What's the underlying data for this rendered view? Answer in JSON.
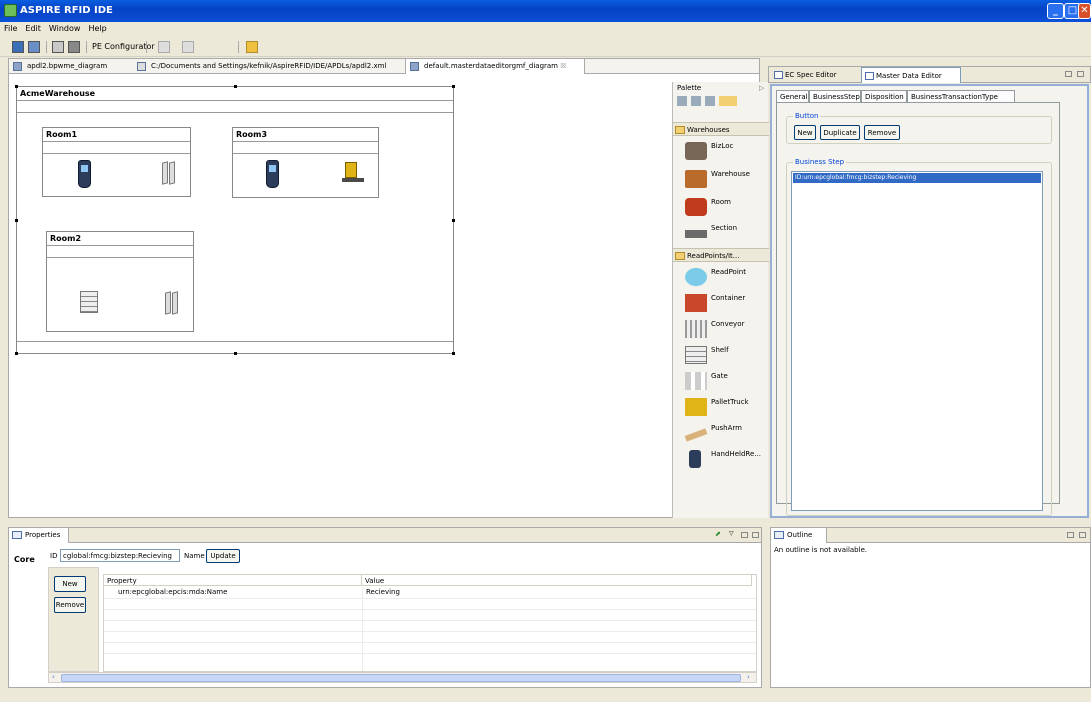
{
  "window": {
    "title": "ASPIRE RFID IDE"
  },
  "menu": [
    "File",
    "Edit",
    "Window",
    "Help"
  ],
  "toolbar": {
    "pe_configurator": "PE Configurator"
  },
  "editor_tabs": [
    {
      "label": "apdl2.bpwme_diagram"
    },
    {
      "label": "C:/Documents and Settings/kefnik/AspireRFID/IDE/APDLs/apdl2.xml"
    },
    {
      "label": "default.masterdataeditorgmf_diagram",
      "close": "☒"
    }
  ],
  "diagram": {
    "warehouse": "AcmeWarehouse",
    "rooms": [
      "Room1",
      "Room3",
      "Room2"
    ]
  },
  "palette": {
    "title": "Palette",
    "group1": "Warehouses",
    "group1_items": [
      "BizLoc",
      "Warehouse",
      "Room",
      "Section"
    ],
    "group2": "ReadPoints/It...",
    "group2_items": [
      "ReadPoint",
      "Container",
      "Conveyor",
      "Shelf",
      "Gate",
      "PalletTruck",
      "PushArm",
      "HandHeldRe..."
    ]
  },
  "right_tabs": [
    "EC Spec Editor",
    "Master Data Editor"
  ],
  "master_data": {
    "tabs": [
      "General",
      "BusinessStep",
      "Disposition",
      "BusinessTransactionType"
    ],
    "button_group": "Button",
    "buttons": [
      "New",
      "Duplicate",
      "Remove"
    ],
    "business_step_group": "Business Step",
    "selected_item": "ID:urn:epcglobal:fmcg:bizstep:Recieving"
  },
  "properties": {
    "tab": "Properties",
    "core_label": "Core",
    "id_label": "ID",
    "id_value": "cglobal:fmcg:bizstep:Recieving",
    "name_label": "Name",
    "update": "Update",
    "new": "New",
    "remove": "Remove",
    "col_property": "Property",
    "col_value": "Value",
    "row_property": "urn:epcglobal:epcis:mda:Name",
    "row_value": "Recieving"
  },
  "outline": {
    "tab": "Outline",
    "message": "An outline is not available."
  },
  "colors": {
    "titlebar": "#0a4ad0",
    "selection": "#316ac5",
    "group_caption": "#0046d5"
  }
}
